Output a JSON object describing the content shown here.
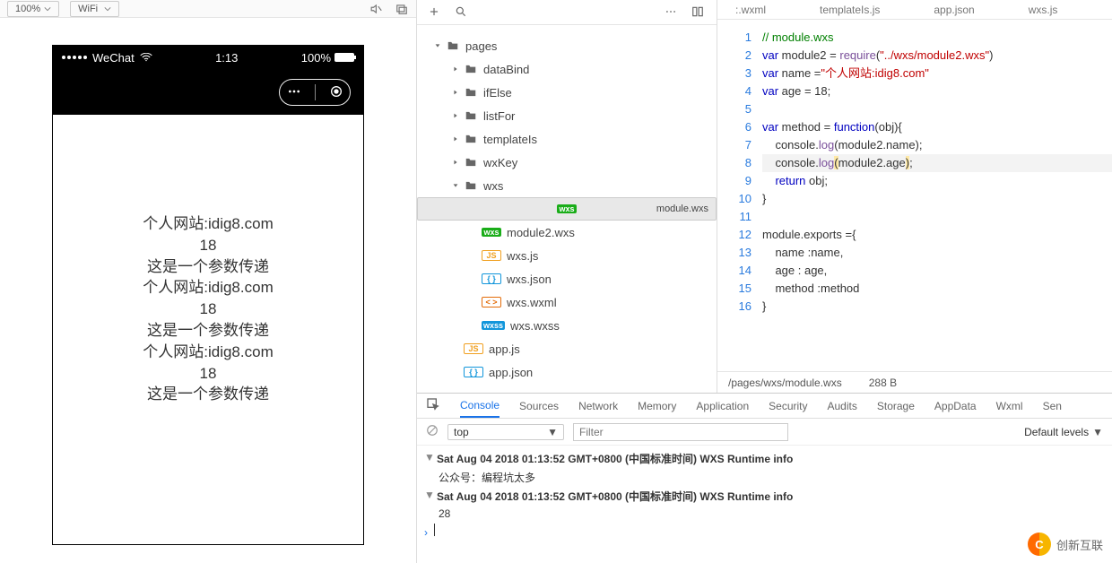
{
  "toolbar": {
    "zoom": "100%",
    "network": "WiFi"
  },
  "simulator": {
    "carrier": "WeChat",
    "time": "1:13",
    "battery": "100%",
    "page_lines": [
      "个人网站:idig8.com",
      "18",
      "这是一个参数传递",
      "个人网站:idig8.com",
      "18",
      "这是一个参数传递",
      "个人网站:idig8.com",
      "18",
      "这是一个参数传递"
    ]
  },
  "explorer": {
    "root": "pages",
    "folders": [
      "dataBind",
      "ifElse",
      "listFor",
      "templateIs",
      "wxKey",
      "wxs"
    ],
    "wxs_files": [
      {
        "badge": "wxs",
        "name": "module.wxs",
        "cls": "b-wxs",
        "selected": true
      },
      {
        "badge": "wxs",
        "name": "module2.wxs",
        "cls": "b-wxs"
      },
      {
        "badge": "JS",
        "name": "wxs.js",
        "cls": "b-js"
      },
      {
        "badge": "{ }",
        "name": "wxs.json",
        "cls": "b-json"
      },
      {
        "badge": "< >",
        "name": "wxs.wxml",
        "cls": "b-wxml"
      },
      {
        "badge": "wxss",
        "name": "wxs.wxss",
        "cls": "b-wxss"
      }
    ],
    "root_files": [
      {
        "badge": "JS",
        "name": "app.js",
        "cls": "b-js"
      },
      {
        "badge": "{ }",
        "name": "app.json",
        "cls": "b-json"
      }
    ]
  },
  "editor": {
    "tabs": [
      ":.wxml",
      "templateIs.js",
      "app.json",
      "wxs.js"
    ],
    "status_path": "/pages/wxs/module.wxs",
    "status_size": "288 B",
    "code": [
      {
        "n": 1,
        "kind": "cmt",
        "text": "// module.wxs"
      },
      {
        "n": 2,
        "kind": "decl",
        "kw": "var",
        "id": "module2",
        "rhs_fn": "require",
        "str": "\"../wxs/module2.wxs\""
      },
      {
        "n": 3,
        "kind": "decl",
        "kw": "var",
        "id": "name",
        "rhs_str": "\"个人网站:idig8.com\""
      },
      {
        "n": 4,
        "kind": "plain",
        "text": "var age = 18;"
      },
      {
        "n": 5,
        "kind": "plain",
        "text": ""
      },
      {
        "n": 6,
        "kind": "fn",
        "text": "var method = function(obj){"
      },
      {
        "n": 7,
        "kind": "log",
        "text": "    console.log(module2.name);"
      },
      {
        "n": 8,
        "kind": "loghl",
        "pre": "    console.log(module2.age",
        "post": ";"
      },
      {
        "n": 9,
        "kind": "ret",
        "text": "    return obj;"
      },
      {
        "n": 10,
        "kind": "plain",
        "text": "}"
      },
      {
        "n": 11,
        "kind": "plain",
        "text": ""
      },
      {
        "n": 12,
        "kind": "plain",
        "text": "module.exports ={"
      },
      {
        "n": 13,
        "kind": "plain",
        "text": "    name :name,"
      },
      {
        "n": 14,
        "kind": "plain",
        "text": "    age : age,"
      },
      {
        "n": 15,
        "kind": "plain",
        "text": "    method :method"
      },
      {
        "n": 16,
        "kind": "plain",
        "text": "}"
      }
    ]
  },
  "devtools": {
    "tabs": [
      "Console",
      "Sources",
      "Network",
      "Memory",
      "Application",
      "Security",
      "Audits",
      "Storage",
      "AppData",
      "Wxml",
      "Sen"
    ],
    "active_tab": 0,
    "context": "top",
    "filter_placeholder": "Filter",
    "levels": "Default levels",
    "logs": [
      {
        "type": "group",
        "text": "Sat Aug 04 2018 01:13:52 GMT+0800 (中国标准时间) WXS Runtime info"
      },
      {
        "type": "child",
        "text": "公众号：编程坑太多"
      },
      {
        "type": "group",
        "text": "Sat Aug 04 2018 01:13:52 GMT+0800 (中国标准时间) WXS Runtime info"
      },
      {
        "type": "child",
        "text": "28"
      }
    ]
  },
  "watermark": "创新互联"
}
